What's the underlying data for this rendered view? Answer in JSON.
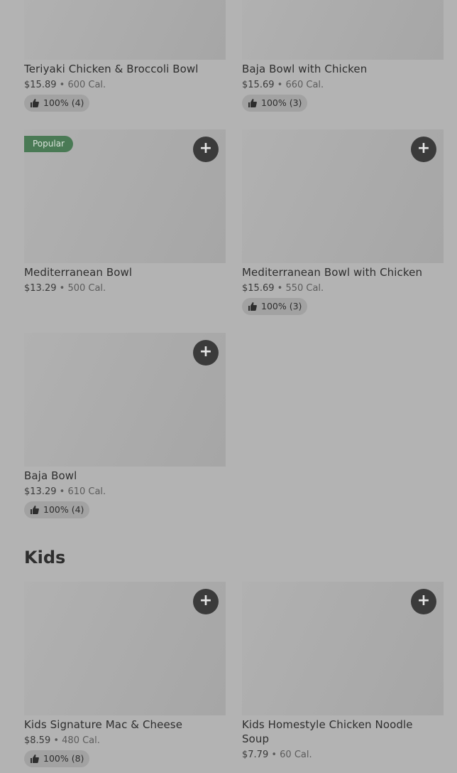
{
  "items": [
    {
      "name": "Teriyaki Chicken & Broccoli Bowl",
      "price": "$15.89",
      "sep": " • ",
      "cal": "600 Cal.",
      "rating": "100% (4)"
    },
    {
      "name": "Baja Bowl with Chicken",
      "price": "$15.69",
      "sep": " • ",
      "cal": "660 Cal.",
      "rating": "100% (3)"
    },
    {
      "name": "Mediterranean Bowl",
      "price": "$13.29",
      "sep": " • ",
      "cal": "500 Cal.",
      "badge": "Popular"
    },
    {
      "name": "Mediterranean Bowl with Chicken",
      "price": "$15.69",
      "sep": " • ",
      "cal": "550 Cal.",
      "rating": "100% (3)"
    },
    {
      "name": "Baja Bowl",
      "price": "$13.29",
      "sep": " • ",
      "cal": "610 Cal.",
      "rating": "100% (4)"
    }
  ],
  "kids": {
    "title": "Kids",
    "items": [
      {
        "name": "Kids Signature Mac & Cheese",
        "price": "$8.59",
        "sep": " • ",
        "cal": "480 Cal.",
        "rating": "100% (8)"
      },
      {
        "name": "Kids Homestyle Chicken Noodle Soup",
        "price": "$7.79",
        "sep": " • ",
        "cal": "60 Cal."
      }
    ]
  },
  "add_label": "+"
}
